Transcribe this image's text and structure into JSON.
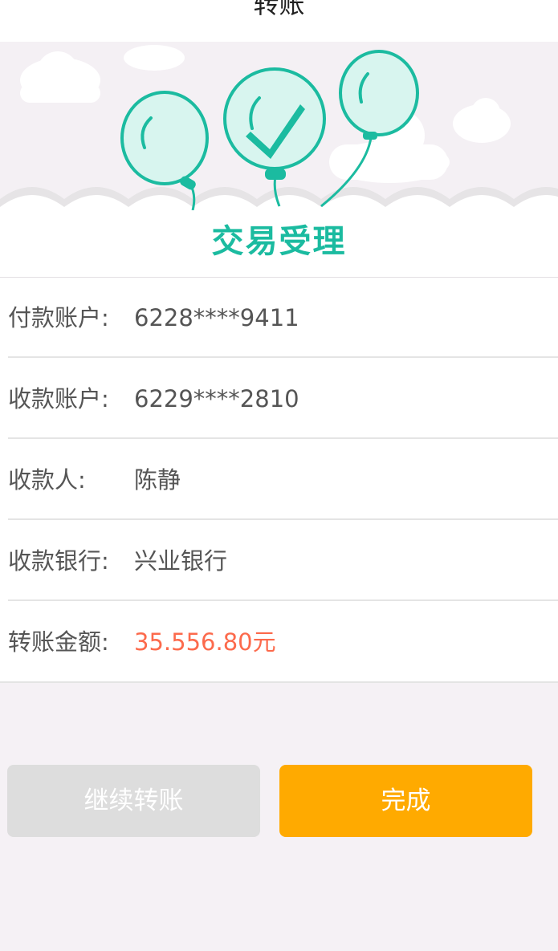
{
  "header": {
    "title": "转账"
  },
  "banner": {
    "title": "交易受理",
    "colors": {
      "accent": "#1bbba0",
      "balloon_fill": "#d8f5ef"
    }
  },
  "details": {
    "rows": [
      {
        "label": "付款账户:",
        "value": "6228****9411"
      },
      {
        "label": "收款账户:",
        "value": "6229****2810"
      },
      {
        "label": "收款人:",
        "value": "陈静"
      },
      {
        "label": "收款银行:",
        "value": "兴业银行"
      },
      {
        "label": "转账金额:",
        "value": "35.556.80元"
      }
    ],
    "amount_color": "#fc6a4c"
  },
  "actions": {
    "continue_label": "继续转账",
    "done_label": "完成",
    "continue_color": "#dddddd",
    "done_color": "#ffaa00"
  }
}
